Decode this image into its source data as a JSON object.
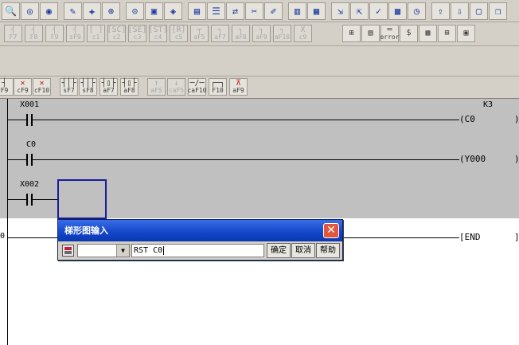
{
  "toolbar_row1_icons": [
    "zoom-icon",
    "find-icon",
    "find-next-icon",
    "pen-icon",
    "ladder-write-icon",
    "search-icon",
    "search-device-icon",
    "monitor-icon",
    "monitor-search-icon",
    "device-list-icon",
    "program-check-icon",
    "transfer-icon",
    "cross-ref-icon",
    "edit-icon",
    "print-icon",
    "print-setup-icon",
    "write-plc-icon",
    "read-plc-icon",
    "verify-icon",
    "matrix-icon",
    "clock-icon",
    "upload-icon",
    "download-icon",
    "window-icon",
    "window2-icon"
  ],
  "toolbar_row2": [
    {
      "g": "┤",
      "k": "F7",
      "dis": true
    },
    {
      "g": "┤",
      "k": "F8",
      "dis": true
    },
    {
      "g": "┤",
      "k": "F9",
      "dis": true
    },
    {
      "g": "┤",
      "k": "sF9",
      "dis": true
    },
    {
      "g": "[ ]",
      "k": "c1",
      "dis": true
    },
    {
      "g": "[SC]",
      "k": "c2",
      "dis": true
    },
    {
      "g": "[SE]",
      "k": "c3",
      "dis": true
    },
    {
      "g": "[ST]",
      "k": "c4",
      "dis": true
    },
    {
      "g": "[R]",
      "k": "c5",
      "dis": true
    },
    {
      "g": "┬",
      "k": "aF5",
      "dis": true
    },
    {
      "g": "┐",
      "k": "aF7",
      "dis": true
    },
    {
      "g": "┐",
      "k": "aF8",
      "dis": true
    },
    {
      "g": "┐",
      "k": "aF9",
      "dis": true
    },
    {
      "g": "┐",
      "k": "aF10",
      "dis": true
    },
    {
      "g": "X",
      "k": "c9",
      "dis": true
    }
  ],
  "toolbar_row2b": [
    {
      "g": "⊞",
      "k": ""
    },
    {
      "g": "▤",
      "k": ""
    },
    {
      "g": "═",
      "k": "error"
    },
    {
      "g": "$",
      "k": ""
    },
    {
      "g": "▦",
      "k": ""
    },
    {
      "g": "⊞",
      "k": ""
    },
    {
      "g": "▣",
      "k": ""
    }
  ],
  "toolbar_row3": [
    {
      "g": "┤",
      "k": "F9",
      "cls": ""
    },
    {
      "g": "✕",
      "k": "cF9",
      "cls": "red"
    },
    {
      "g": "✕",
      "k": "cF10",
      "cls": "red"
    },
    {
      "g": "┤│├",
      "k": "sF7",
      "cls": ""
    },
    {
      "g": "┤│├",
      "k": "sF8",
      "cls": ""
    },
    {
      "g": "┤▯├",
      "k": "aF7",
      "cls": ""
    },
    {
      "g": "┤▯├",
      "k": "aF8",
      "cls": ""
    },
    {
      "g": "↑",
      "k": "aF5",
      "cls": "dis"
    },
    {
      "g": "↓",
      "k": "caF5",
      "cls": "dis"
    },
    {
      "g": "─/─",
      "k": "caF10",
      "cls": ""
    },
    {
      "g": "┌─┐",
      "k": "F10",
      "cls": ""
    },
    {
      "g": "⊼",
      "k": "aF9",
      "cls": "red"
    }
  ],
  "ladder": {
    "rung1": {
      "contact": "X001",
      "coil": "(C0",
      "const": "K3",
      "end_bracket": ")"
    },
    "rung2": {
      "contact": "C0",
      "coil": "(Y000",
      "end_bracket": ")"
    },
    "rung3": {
      "contact": "X002"
    },
    "rung4": {
      "step": "0",
      "coil": "[END",
      "end_bracket": "]"
    }
  },
  "dialog": {
    "title": "梯形图输入",
    "close": "✕",
    "select_value": "",
    "instruction_value": "RST C0",
    "ok": "确定",
    "cancel": "取消",
    "help": "帮助"
  }
}
